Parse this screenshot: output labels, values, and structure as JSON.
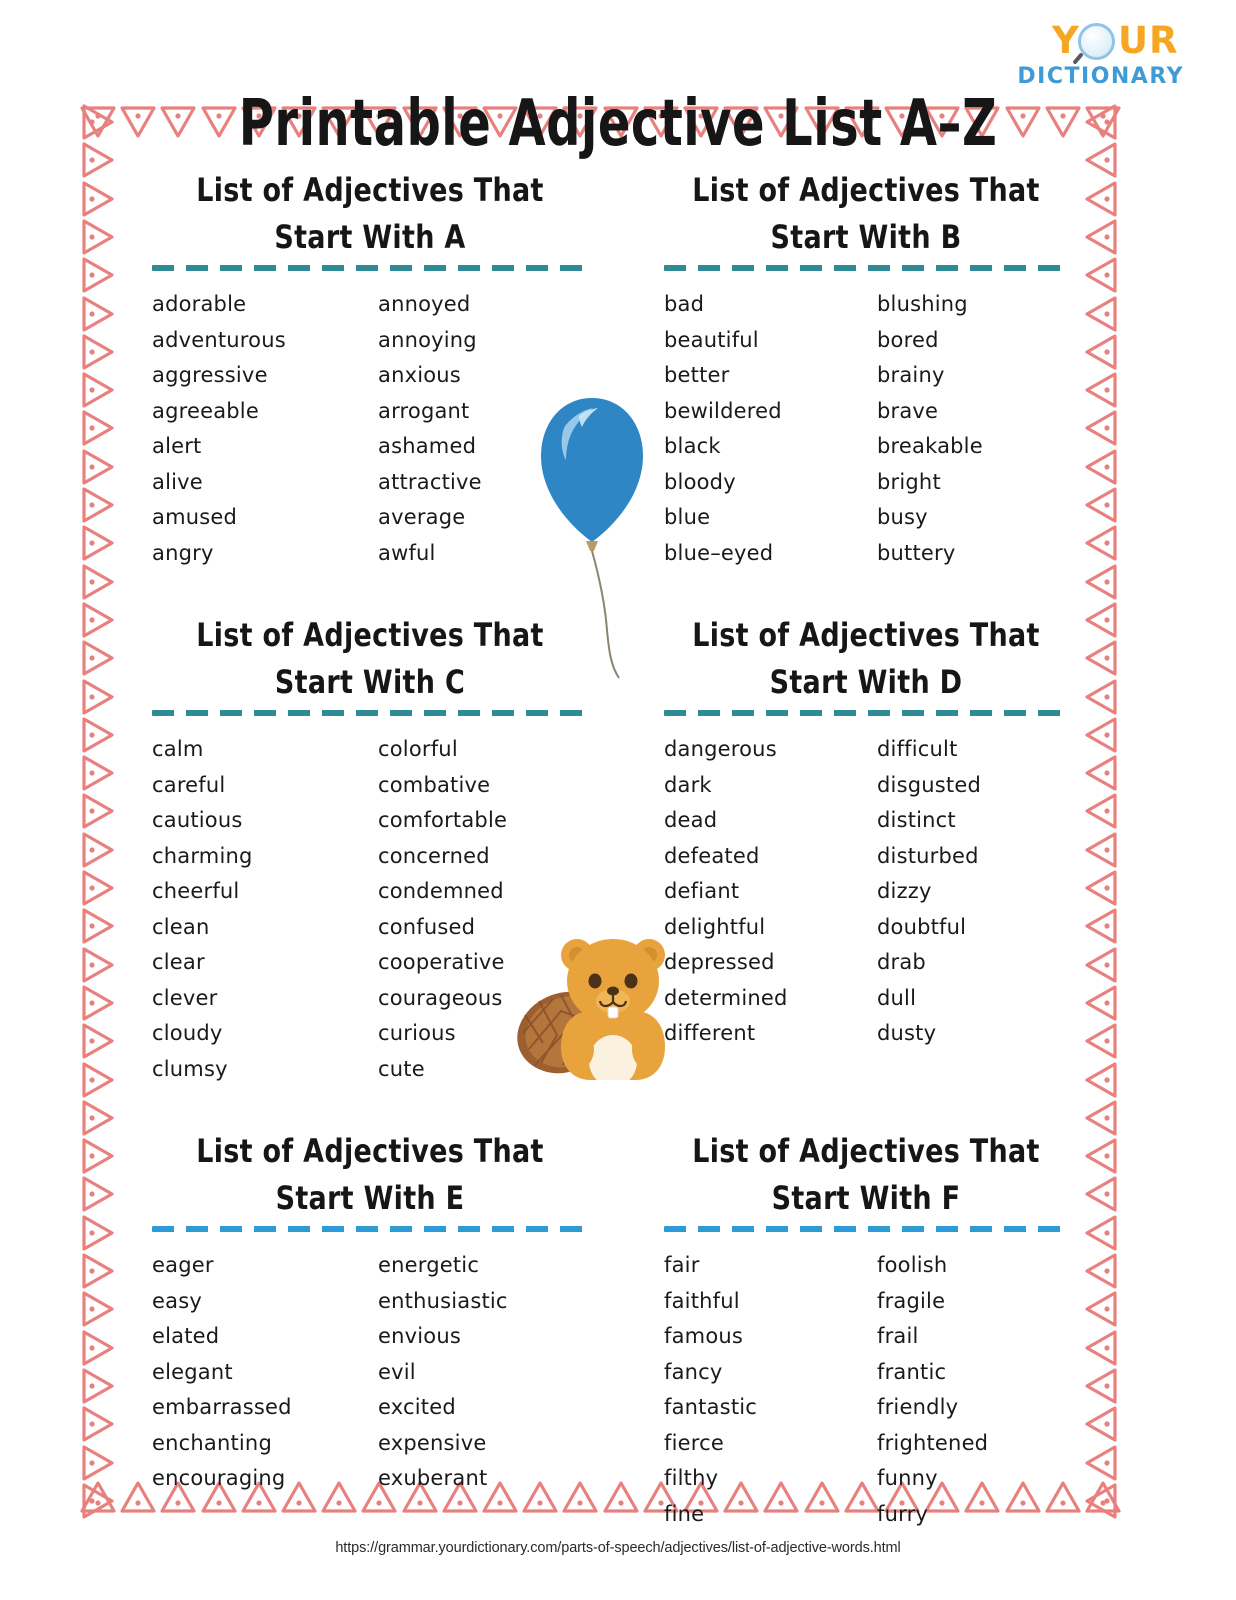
{
  "document": {
    "title": "Printable Adjective List A–Z",
    "footer_url": "https://grammar.yourdictionary.com/parts-of-speech/adjectives/list-of-adjective-words.html"
  },
  "logo": {
    "word_top_left": "Y",
    "word_top_right": "UR",
    "word_bottom": "DICTIONARY",
    "color_orange": "#F5A623",
    "color_blue": "#3E9BD5"
  },
  "colors": {
    "divider_teal": "#2E8B95",
    "divider_blue": "#2E9BD6",
    "border_pink": "#E8817E",
    "balloon_blue": "#2E87C4",
    "beaver_body": "#E8A33D",
    "beaver_tail": "#9C5F30",
    "text": "#1a1a1a"
  },
  "sections": [
    {
      "id": "a",
      "heading_line1": "List of Adjectives That",
      "heading_line2": "Start With A",
      "divider_color": "#2E8B95",
      "col1": [
        "adorable",
        "adventurous",
        "aggressive",
        "agreeable",
        "alert",
        "alive",
        "amused",
        "angry"
      ],
      "col2": [
        "annoyed",
        "annoying",
        "anxious",
        "arrogant",
        "ashamed",
        "attractive",
        "average",
        "awful"
      ]
    },
    {
      "id": "b",
      "heading_line1": "List of Adjectives That",
      "heading_line2": "Start With B",
      "divider_color": "#2E8B95",
      "col1": [
        "bad",
        "beautiful",
        "better",
        "bewildered",
        "black",
        "bloody",
        "blue",
        "blue–eyed"
      ],
      "col2": [
        "blushing",
        "bored",
        "brainy",
        "brave",
        "breakable",
        "bright",
        "busy",
        "buttery"
      ]
    },
    {
      "id": "c",
      "heading_line1": "List of Adjectives That",
      "heading_line2": "Start With C",
      "divider_color": "#2E8B95",
      "col1": [
        "calm",
        "careful",
        "cautious",
        "charming",
        "cheerful",
        "clean",
        "clear",
        "clever",
        "cloudy",
        "clumsy"
      ],
      "col2": [
        "colorful",
        "combative",
        "comfortable",
        "concerned",
        "condemned",
        "confused",
        "cooperative",
        "courageous",
        "curious",
        "cute"
      ]
    },
    {
      "id": "d",
      "heading_line1": "List of Adjectives That",
      "heading_line2": "Start With D",
      "divider_color": "#2E8B95",
      "col1": [
        "dangerous",
        "dark",
        "dead",
        "defeated",
        "defiant",
        "delightful",
        "depressed",
        "determined",
        "different"
      ],
      "col2": [
        "difficult",
        "disgusted",
        "distinct",
        "disturbed",
        "dizzy",
        "doubtful",
        "drab",
        "dull",
        "dusty"
      ]
    },
    {
      "id": "e",
      "heading_line1": "List of Adjectives That",
      "heading_line2": "Start With E",
      "divider_color": "#2E9BD6",
      "col1": [
        "eager",
        "easy",
        "elated",
        "elegant",
        "embarrassed",
        "enchanting",
        "encouraging"
      ],
      "col2": [
        "energetic",
        "enthusiastic",
        "envious",
        "evil",
        "excited",
        "expensive",
        "exuberant"
      ]
    },
    {
      "id": "f",
      "heading_line1": "List of Adjectives That",
      "heading_line2": "Start With F",
      "divider_color": "#2E9BD6",
      "col1": [
        "fair",
        "faithful",
        "famous",
        "fancy",
        "fantastic",
        "fierce",
        "filthy",
        "fine"
      ],
      "col2": [
        "foolish",
        "fragile",
        "frail",
        "frantic",
        "friendly",
        "frightened",
        "funny",
        "furry"
      ]
    }
  ],
  "illustrations": [
    {
      "name": "balloon",
      "description": "blue balloon with string"
    },
    {
      "name": "beaver",
      "description": "cartoon beaver with flat tail"
    }
  ]
}
